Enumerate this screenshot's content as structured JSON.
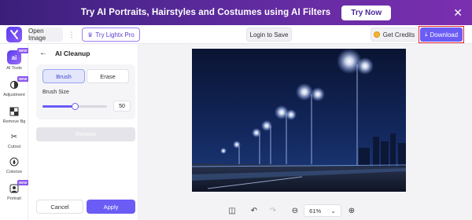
{
  "banner": {
    "text": "Try AI Portraits, Hairstyles and Costumes using AI Filters",
    "button_label": "Try Now",
    "close_icon": "close-icon"
  },
  "topbar": {
    "open_image_label": "Open Image",
    "more_icon": "more-vertical-icon",
    "try_pro_label": "Try Lightx Pro",
    "login_label": "Login to Save",
    "credits_label": "Get Credits",
    "download_label": "Download",
    "colors": {
      "accent": "#6a5cf5",
      "highlight": "#e3202a"
    }
  },
  "rail": {
    "items": [
      {
        "label": "AI Tools",
        "icon": "ai-tools-icon",
        "tag": "NEW"
      },
      {
        "label": "Adjustment",
        "icon": "adjustment-icon",
        "tag": "NEW"
      },
      {
        "label": "Remove Bg",
        "icon": "remove-bg-icon"
      },
      {
        "label": "Cutout",
        "icon": "scissors-icon"
      },
      {
        "label": "Colorize",
        "icon": "colorize-icon"
      },
      {
        "label": "Portrait",
        "icon": "portrait-icon",
        "tag": "NEW"
      }
    ],
    "ai_icon_text": "ai"
  },
  "panel": {
    "title": "AI Cleanup",
    "brush_label": "Brush",
    "erase_label": "Erase",
    "brush_size_label": "Brush Size",
    "brush_size_value": "50",
    "brush_size_fraction": 0.5,
    "remove_label": "Remove",
    "cancel_label": "Cancel",
    "apply_label": "Apply"
  },
  "bottom": {
    "zoom_value": "61%",
    "compare_icon": "compare-icon",
    "undo_icon": "undo-icon",
    "redo_icon": "redo-icon",
    "zoom_out_icon": "zoom-out-icon",
    "zoom_in_icon": "zoom-in-icon"
  }
}
